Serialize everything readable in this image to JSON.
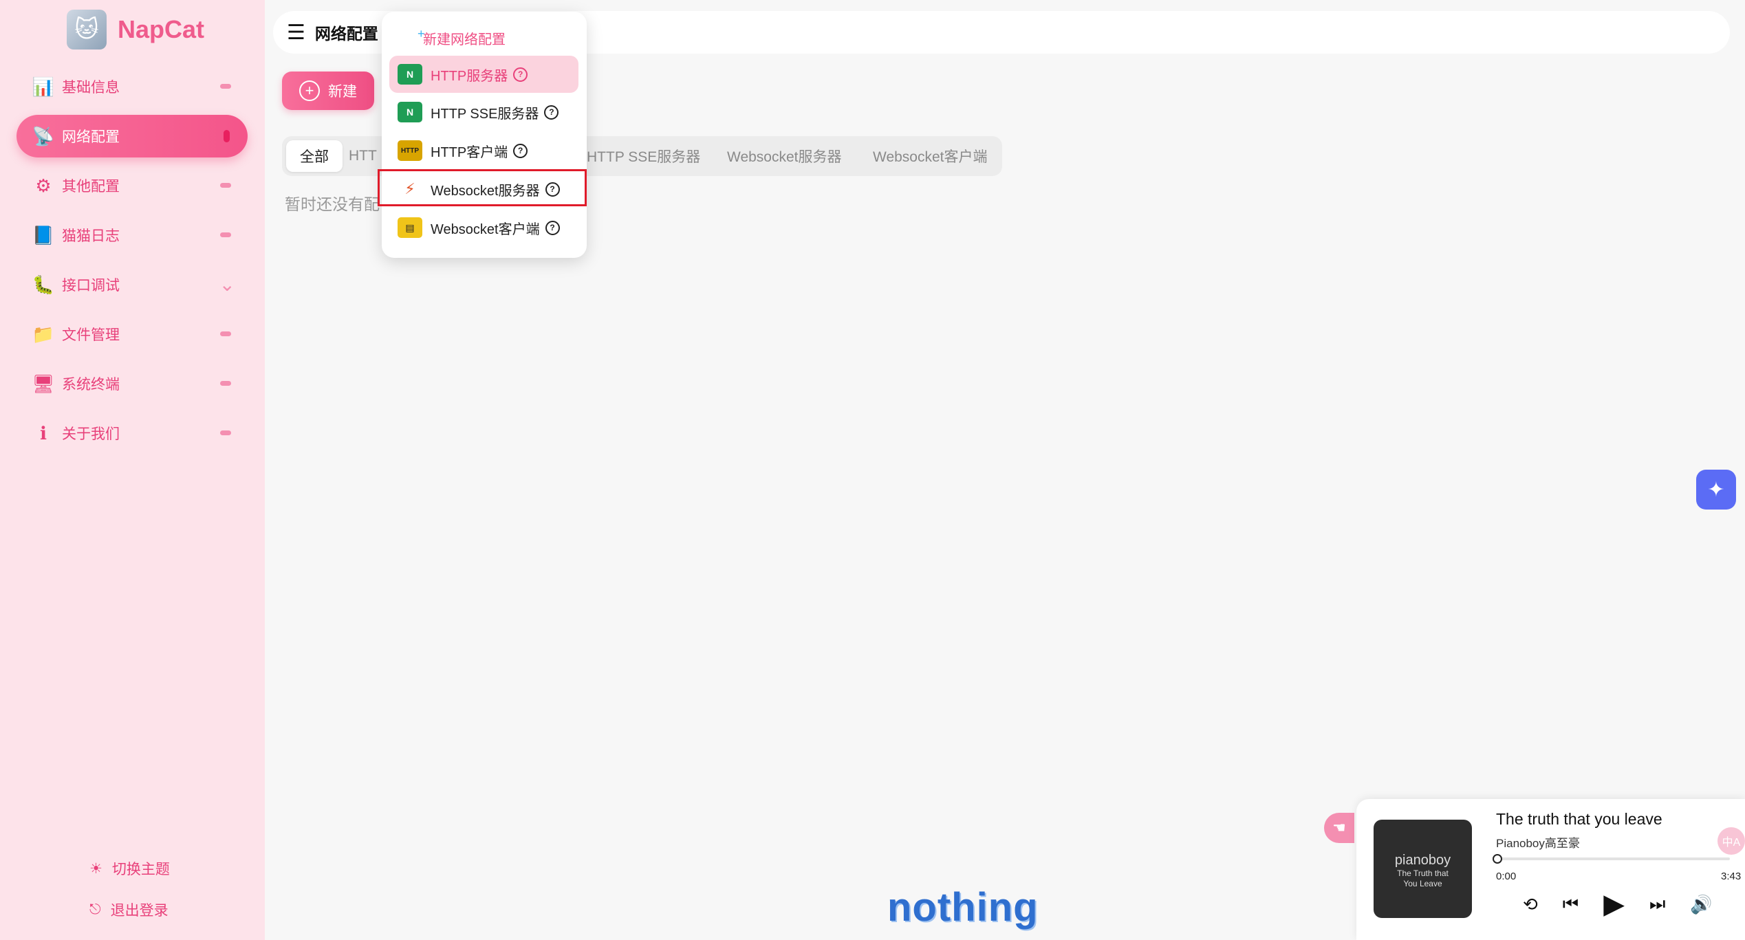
{
  "brand": {
    "name": "NapCat"
  },
  "sidebar": {
    "items": [
      {
        "label": "基础信息",
        "icon": "dashboard-icon"
      },
      {
        "label": "网络配置",
        "icon": "network-icon"
      },
      {
        "label": "其他配置",
        "icon": "settings-icon"
      },
      {
        "label": "猫猫日志",
        "icon": "log-icon"
      },
      {
        "label": "接口调试",
        "icon": "debug-icon"
      },
      {
        "label": "文件管理",
        "icon": "folder-icon"
      },
      {
        "label": "系统终端",
        "icon": "terminal-icon"
      },
      {
        "label": "关于我们",
        "icon": "about-icon"
      }
    ],
    "theme_label": "切换主题",
    "logout_label": "退出登录"
  },
  "header": {
    "title": "网络配置"
  },
  "toolbar": {
    "new_label": "新建"
  },
  "tabs": [
    "全部",
    "HTTP服务器",
    "HTTP客户端",
    "HTTP SSE服务器",
    "Websocket服务器",
    "Websocket客户端"
  ],
  "tabs_visible": [
    "全部",
    "HTT",
    "HTTP SSE服务器",
    "Websocket服务器",
    "Websocket客户端"
  ],
  "empty_text": "暂时还没有配",
  "dropdown": {
    "header": "新建网络配置",
    "items": [
      {
        "label": "HTTP服务器",
        "icon": "nginx-icon"
      },
      {
        "label": "HTTP SSE服务器",
        "icon": "nginx-icon"
      },
      {
        "label": "HTTP客户端",
        "icon": "http-icon"
      },
      {
        "label": "Websocket服务器",
        "icon": "websocket-server-icon"
      },
      {
        "label": "Websocket客户端",
        "icon": "monitor-icon"
      }
    ]
  },
  "player": {
    "title": "The truth that you leave",
    "artist": "Pianoboy高至豪",
    "cover_title": "pianoboy",
    "cover_sub1": "The Truth that",
    "cover_sub2": "You Leave",
    "time_current": "0:00",
    "time_total": "3:43",
    "progress": 0.0
  },
  "translate_label": "中A",
  "watermark": "nothing",
  "colors": {
    "accent": "#ef4f84",
    "highlight": "#e01b2a",
    "float": "#5b6cf5"
  }
}
